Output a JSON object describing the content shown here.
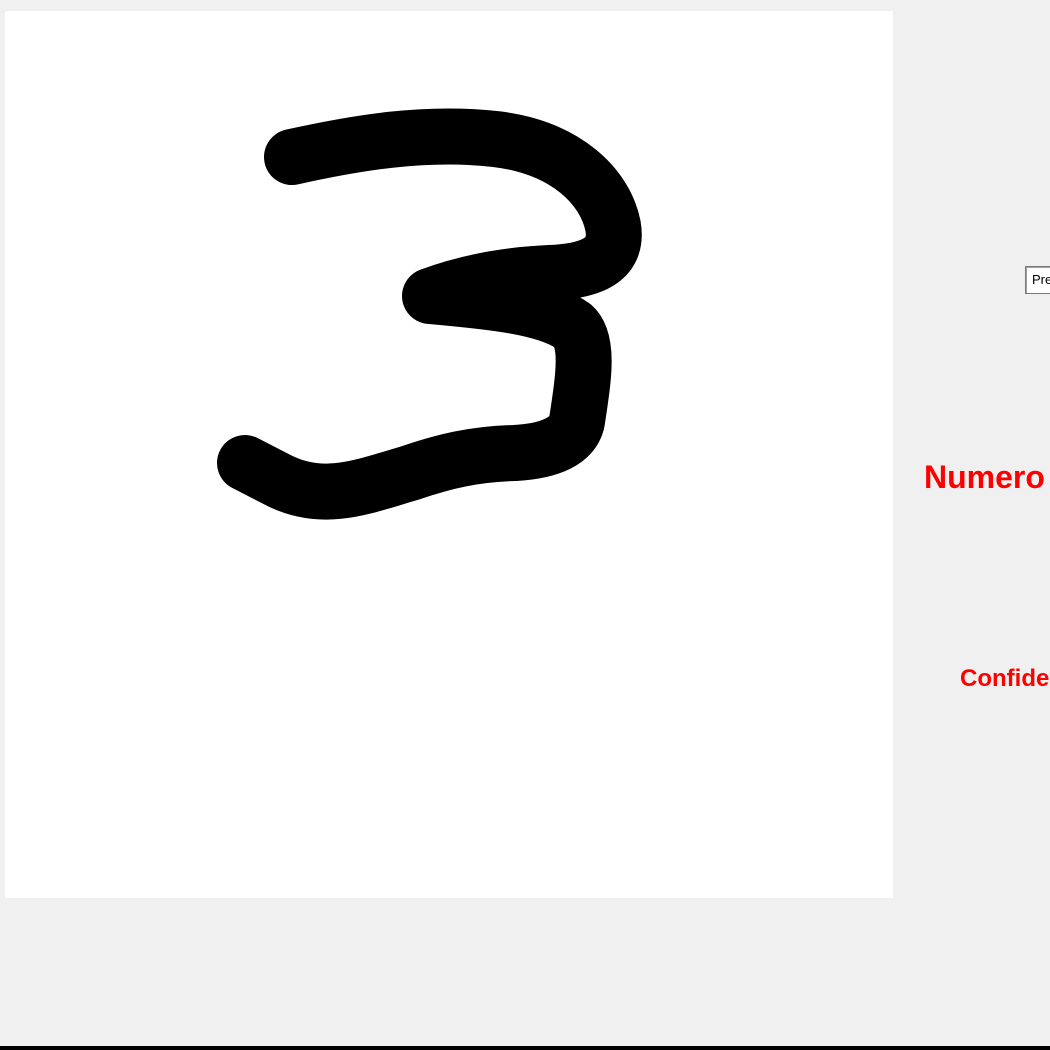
{
  "canvas": {
    "background_color": "#ffffff",
    "stroke_color": "#000000",
    "drawn_content": "3"
  },
  "controls": {
    "predict_label": "Predict"
  },
  "result": {
    "number_label": "Numero",
    "confidence_label": "Confidence",
    "text_color": "#ff0000"
  },
  "window": {
    "background_color": "#f0f0f0"
  }
}
